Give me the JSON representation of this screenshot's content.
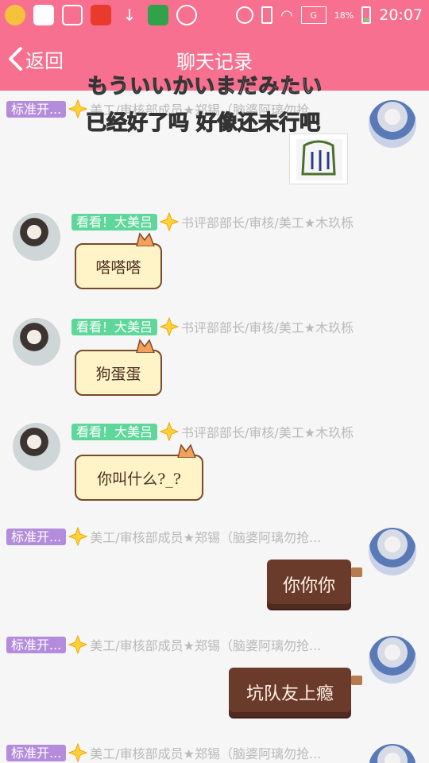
{
  "status_bar": {
    "battery_percent": "18%",
    "time": "20:07",
    "signal_label": "G"
  },
  "header": {
    "back_label": "返回",
    "title": "聊天记录"
  },
  "overlay": {
    "line1_green": "もういいかい",
    "line1_rest": "まだみたい",
    "line2": "已经好了吗 好像还未行吧"
  },
  "messages": [
    {
      "side": "right",
      "badge": "标准开...",
      "meta": "美工/审核部成员★郑锡（脑婆阿璃勿抢...",
      "type": "sticker"
    },
    {
      "side": "left",
      "badge": "看看！大美吕",
      "meta": "书评部部长/审核/美工★木玖栎",
      "text": "嗒嗒嗒",
      "type": "scroll"
    },
    {
      "side": "left",
      "badge": "看看！大美吕",
      "meta": "书评部部长/审核/美工★木玖栎",
      "text": "狗蛋蛋",
      "type": "scroll"
    },
    {
      "side": "left",
      "badge": "看看！大美吕",
      "meta": "书评部部长/审核/美工★木玖栎",
      "text": "你叫什么?_?",
      "type": "scroll"
    },
    {
      "side": "right",
      "badge": "标准开...",
      "meta": "美工/审核部成员★郑锡（脑婆阿璃勿抢...",
      "text": "你你你",
      "type": "choc"
    },
    {
      "side": "right",
      "badge": "标准开...",
      "meta": "美工/审核部成员★郑锡（脑婆阿璃勿抢...",
      "text": "坑队友上瘾",
      "type": "choc"
    },
    {
      "side": "right",
      "badge": "标准开...",
      "meta": "美工/审核部成员★郑锡（脑婆阿璃勿抢...",
      "type": "partial"
    }
  ],
  "colors": {
    "header_pink": "#f7708f",
    "badge_purple": "#b48cdc",
    "badge_green": "#5fd79b"
  }
}
